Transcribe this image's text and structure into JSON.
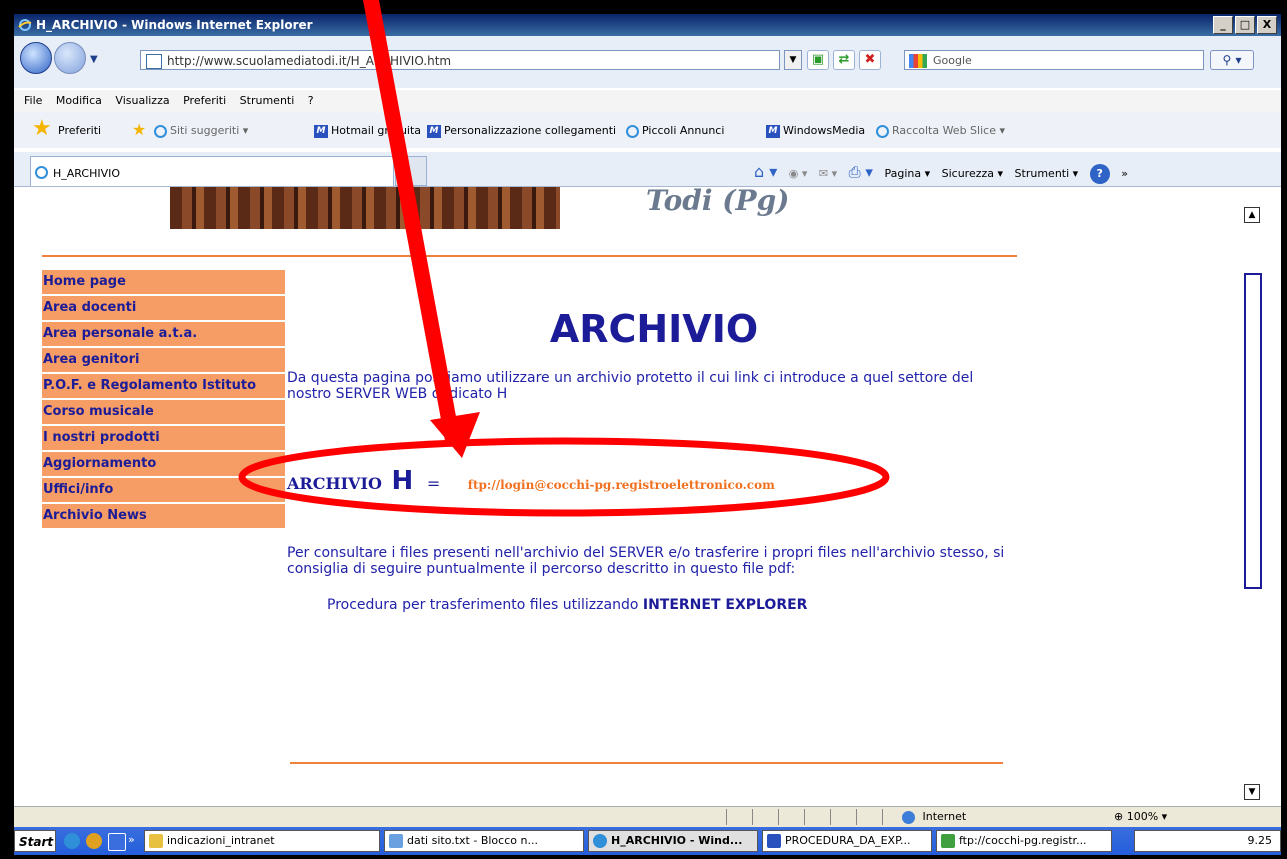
{
  "window": {
    "title": "H_ARCHIVIO - Windows Internet Explorer",
    "min_label": "_",
    "max_label": "□",
    "close_label": "X"
  },
  "address_bar": {
    "url": "http://www.scuolamediatodi.it/H_ARCHIVIO.htm",
    "search_placeholder": "Google"
  },
  "menu": [
    "File",
    "Modifica",
    "Visualizza",
    "Preferiti",
    "Strumenti",
    "?"
  ],
  "favorites": {
    "label": "Preferiti",
    "links": [
      "Siti suggeriti ▾",
      "Hotmail gratuita",
      "Personalizzazione collegamenti",
      "Piccoli Annunci",
      "WindowsMedia",
      "Raccolta Web Slice ▾"
    ]
  },
  "tab": {
    "title": "H_ARCHIVIO"
  },
  "command_bar": [
    "Pagina ▾",
    "Sicurezza ▾",
    "Strumenti ▾"
  ],
  "page": {
    "logo_text": "Todi (Pg)",
    "nav": [
      "Home page",
      "Area docenti",
      "Area personale a.t.a.",
      "Area genitori",
      "P.O.F. e Regolamento Istituto",
      "Corso musicale",
      "I nostri prodotti",
      "Aggiornamento",
      "Uffici/info",
      "Archivio News"
    ],
    "heading": "ARCHIVIO",
    "intro": "Da questa pagina possiamo utilizzare un archivio protetto il cui link ci introduce a quel settore del nostro SERVER WEB dedicato H",
    "archive_label": "ARCHIVIO",
    "archive_letter": "H",
    "archive_equals": "=",
    "ftp_link": "ftp://login@cocchi-pg.registroelettronico.com",
    "description": "Per consultare i files presenti nell'archivio del SERVER e/o trasferire i propri files nell'archivio stesso, si consiglia di seguire puntualmente il percorso descritto in questo file pdf:",
    "procedure_text": "Procedura per trasferimento files utilizzando",
    "procedure_link": "INTERNET EXPLORER"
  },
  "status": {
    "zone": "Internet",
    "zoom": "⊕ 100% ▾"
  },
  "taskbar": {
    "start": "Start",
    "chevron": "»",
    "tasks": [
      "indicazioni_intranet",
      "dati sito.txt - Blocco n...",
      "H_ARCHIVIO - Wind...",
      "PROCEDURA_DA_EXP...",
      "ftp://cocchi-pg.registr..."
    ],
    "clock": "9.25"
  },
  "colors": {
    "nav_bg": "#f59d64",
    "nav_text": "#1c1c99",
    "rule": "#f08040",
    "link": "#f07020",
    "annotation": "#ff0000"
  }
}
